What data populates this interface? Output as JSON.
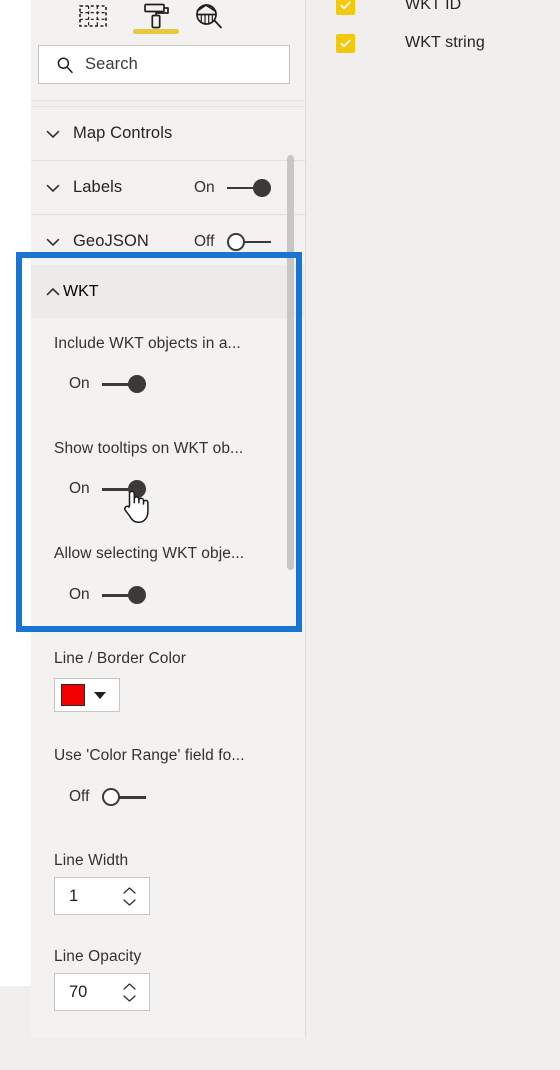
{
  "pane": {
    "tabs": [
      {
        "name": "build-fields-tab",
        "icon": "fields-grid-icon",
        "active": false
      },
      {
        "name": "format-tab",
        "icon": "paint-roller-icon",
        "active": true
      },
      {
        "name": "analytics-tab",
        "icon": "analytics-magnifier-icon",
        "active": false
      }
    ],
    "active_tab_accent": "#e8c93b",
    "search": {
      "placeholder": "Search",
      "value": "",
      "icon": "search-icon"
    },
    "sections": [
      {
        "title": "Map Controls",
        "expanded": false,
        "chevron": "chevron-down-icon",
        "has_toggle": false
      },
      {
        "title": "Labels",
        "expanded": false,
        "chevron": "chevron-down-icon",
        "has_toggle": true,
        "toggle_state": "On"
      },
      {
        "title": "GeoJSON",
        "expanded": false,
        "chevron": "chevron-down-icon",
        "has_toggle": true,
        "toggle_state": "Off"
      }
    ],
    "wkt_section": {
      "title": "WKT",
      "expanded": true,
      "chevron": "chevron-up-icon",
      "properties": [
        {
          "label": "Include WKT objects in a...",
          "type": "toggle",
          "state": "On"
        },
        {
          "label": "Show tooltips on WKT ob...",
          "type": "toggle",
          "state": "On"
        },
        {
          "label": "Allow selecting WKT obje...",
          "type": "toggle",
          "state": "On"
        }
      ]
    },
    "below_properties": {
      "line_border_color": {
        "label": "Line / Border Color",
        "swatch_color": "#f20000",
        "caret": "chevron-down-icon"
      },
      "color_range_toggle": {
        "label": "Use 'Color Range' field fo...",
        "state": "Off"
      },
      "line_width": {
        "label": "Line Width",
        "value": "1",
        "up_icon": "chevron-up-icon",
        "down_icon": "chevron-down-icon"
      },
      "line_opacity": {
        "label": "Line Opacity",
        "value": "70",
        "up_icon": "chevron-up-icon",
        "down_icon": "chevron-down-icon"
      }
    }
  },
  "field_list": {
    "checkbox_color": "#f2c811",
    "items": [
      {
        "label": "WKT ID",
        "checked": true
      },
      {
        "label": "WKT string",
        "checked": true
      }
    ]
  },
  "annotation": {
    "highlight_color": "#1a74d2",
    "target": "WKT"
  },
  "cursor": {
    "type": "hand-pointer"
  }
}
